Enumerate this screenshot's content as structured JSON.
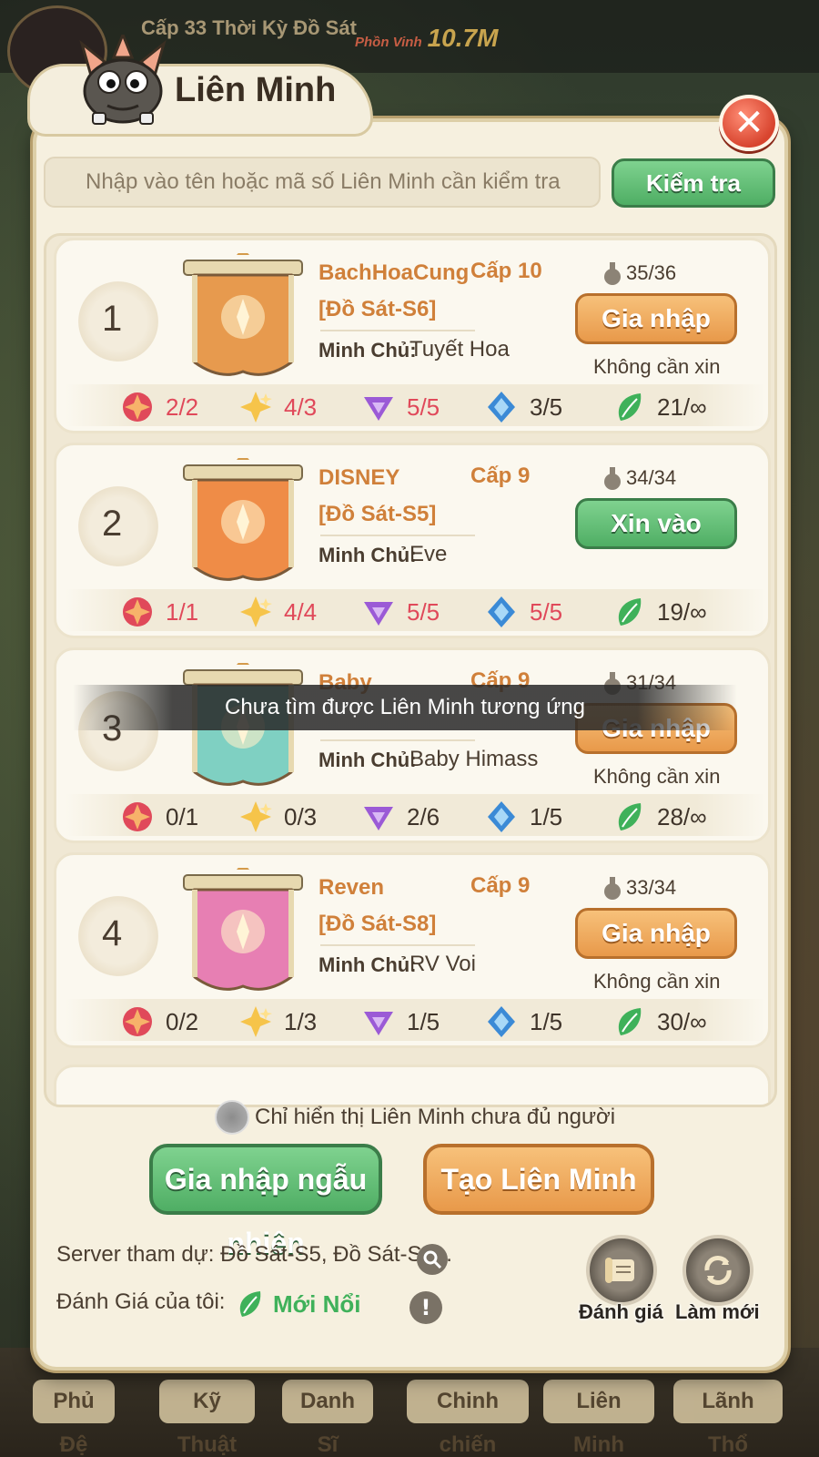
{
  "header": {
    "level_text": "Cấp 33 Thời Kỳ Đồ Sát",
    "prosperity_label": "Phồn Vinh",
    "prosperity_value": "10.7M"
  },
  "panel": {
    "title": "Liên Minh",
    "close_symbol": "✕"
  },
  "search": {
    "placeholder": "Nhập vào tên hoặc mã số Liên Minh cần kiểm tra",
    "value": "",
    "button_label": "Kiểm tra"
  },
  "alliances": [
    {
      "rank": "1",
      "name": "BachHoaCung",
      "level": "Cấp 10",
      "server": "[Đồ Sát-S6]",
      "leader_label": "Minh Chủ:",
      "leader": "Tuyết Hoa",
      "members": "35/36",
      "action": "Gia nhập",
      "action_style": "orange",
      "note": "Không cần xin",
      "stats": [
        "2/2",
        "4/3",
        "5/5",
        "3/5",
        "21/∞"
      ],
      "stat_red": [
        true,
        true,
        true,
        false,
        false
      ],
      "banner_color": "#e79a4e"
    },
    {
      "rank": "2",
      "name": "DISNEY",
      "level": "Cấp 9",
      "server": "[Đồ Sát-S5]",
      "leader_label": "Minh Chủ:",
      "leader": "Eve",
      "members": "34/34",
      "action": "Xin vào",
      "action_style": "green",
      "note": "",
      "stats": [
        "1/1",
        "4/4",
        "5/5",
        "5/5",
        "19/∞"
      ],
      "stat_red": [
        true,
        true,
        true,
        true,
        false
      ],
      "banner_color": "#ef8c47"
    },
    {
      "rank": "3",
      "name": "Baby",
      "level": "Cấp 9",
      "server": "",
      "leader_label": "Minh Chủ:",
      "leader": "Baby Himass",
      "members": "31/34",
      "action": "Gia nhập",
      "action_style": "orange",
      "note": "Không cần xin",
      "stats": [
        "0/1",
        "0/3",
        "2/6",
        "1/5",
        "28/∞"
      ],
      "stat_red": [
        false,
        false,
        false,
        false,
        false
      ],
      "banner_color": "#7fd0c2"
    },
    {
      "rank": "4",
      "name": "Reven",
      "level": "Cấp 9",
      "server": "[Đồ Sát-S8]",
      "leader_label": "Minh Chủ:",
      "leader": "RV Voi",
      "members": "33/34",
      "action": "Gia nhập",
      "action_style": "orange",
      "note": "Không cần xin",
      "stats": [
        "0/2",
        "1/3",
        "1/5",
        "1/5",
        "30/∞"
      ],
      "stat_red": [
        false,
        false,
        false,
        false,
        false
      ],
      "banner_color": "#e77fb3"
    }
  ],
  "toast": "Chưa tìm được Liên Minh tương ứng",
  "filter_label": "Chỉ hiển thị Liên Minh chưa đủ người",
  "buttons": {
    "random_join": "Gia nhập ngẫu nhiên",
    "create": "Tạo Liên Minh"
  },
  "server_info": "Server tham dự: Đồ Sát-S5, Đồ Sát-S6...",
  "rating_label": "Đánh Giá của tôi:",
  "rating_value": "Mới Nổi",
  "round_buttons": {
    "review": "Đánh giá",
    "refresh": "Làm mới"
  },
  "bottom_nav": [
    "Phủ Đệ",
    "Kỹ Thuật",
    "Danh Sĩ",
    "Chinh chiến",
    "Liên Minh",
    "Lãnh Thổ"
  ],
  "icons": {
    "stat_icons": [
      "red-star-icon",
      "gold-sparkle-icon",
      "purple-triangle-icon",
      "blue-diamond-icon",
      "green-leaf-icon"
    ],
    "members_icon": "flask-icon",
    "search_icon": "magnifier-icon",
    "info_icon": "exclamation-icon"
  }
}
